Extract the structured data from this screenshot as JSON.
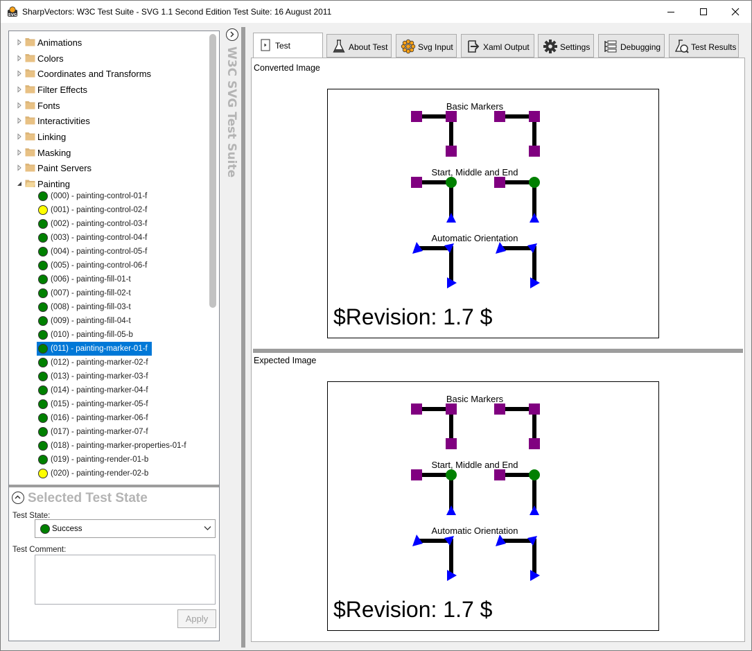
{
  "window": {
    "title": "SharpVectors: W3C Test Suite - SVG 1.1 Second Edition Test Suite: 16 August 2011"
  },
  "tree": {
    "folders": [
      {
        "label": "Animations",
        "expanded": false
      },
      {
        "label": "Colors",
        "expanded": false
      },
      {
        "label": "Coordinates and Transforms",
        "expanded": false
      },
      {
        "label": "Filter Effects",
        "expanded": false
      },
      {
        "label": "Fonts",
        "expanded": false
      },
      {
        "label": "Interactivities",
        "expanded": false
      },
      {
        "label": "Linking",
        "expanded": false
      },
      {
        "label": "Masking",
        "expanded": false
      },
      {
        "label": "Paint Servers",
        "expanded": false
      },
      {
        "label": "Painting",
        "expanded": true
      }
    ],
    "tests": [
      {
        "label": "(000) - painting-control-01-f",
        "status": "green"
      },
      {
        "label": "(001) - painting-control-02-f",
        "status": "yellow"
      },
      {
        "label": "(002) - painting-control-03-f",
        "status": "green"
      },
      {
        "label": "(003) - painting-control-04-f",
        "status": "green"
      },
      {
        "label": "(004) - painting-control-05-f",
        "status": "green"
      },
      {
        "label": "(005) - painting-control-06-f",
        "status": "green"
      },
      {
        "label": "(006) - painting-fill-01-t",
        "status": "green"
      },
      {
        "label": "(007) - painting-fill-02-t",
        "status": "green"
      },
      {
        "label": "(008) - painting-fill-03-t",
        "status": "green"
      },
      {
        "label": "(009) - painting-fill-04-t",
        "status": "green"
      },
      {
        "label": "(010) - painting-fill-05-b",
        "status": "green"
      },
      {
        "label": "(011) - painting-marker-01-f",
        "status": "green",
        "selected": true
      },
      {
        "label": "(012) - painting-marker-02-f",
        "status": "green"
      },
      {
        "label": "(013) - painting-marker-03-f",
        "status": "green"
      },
      {
        "label": "(014) - painting-marker-04-f",
        "status": "green"
      },
      {
        "label": "(015) - painting-marker-05-f",
        "status": "green"
      },
      {
        "label": "(016) - painting-marker-06-f",
        "status": "green"
      },
      {
        "label": "(017) - painting-marker-07-f",
        "status": "green"
      },
      {
        "label": "(018) - painting-marker-properties-01-f",
        "status": "green"
      },
      {
        "label": "(019) - painting-render-01-b",
        "status": "green"
      },
      {
        "label": "(020) - painting-render-02-b",
        "status": "yellow"
      }
    ]
  },
  "state_panel": {
    "title": "Selected Test State",
    "state_label": "Test State:",
    "state_value": "Success",
    "comment_label": "Test Comment:",
    "comment_value": "",
    "apply_label": "Apply"
  },
  "side_strip": {
    "label": "W3C SVG Test Suite"
  },
  "tabs": [
    {
      "label": "Test",
      "icon": "test-page-icon",
      "active": true
    },
    {
      "label": "About Test",
      "icon": "flask-icon"
    },
    {
      "label": "Svg Input",
      "icon": "svg-logo-icon"
    },
    {
      "label": "Xaml Output",
      "icon": "export-arrow-icon"
    },
    {
      "label": "Settings",
      "icon": "gear-icon"
    },
    {
      "label": "Debugging",
      "icon": "debug-icon"
    },
    {
      "label": "Test Results",
      "icon": "test-results-icon"
    }
  ],
  "converted": {
    "section_title": "Converted Image",
    "labels": [
      "Basic Markers",
      "Start, Middle and End",
      "Automatic Orientation"
    ],
    "revision": "$Revision: 1.7 $"
  },
  "expected": {
    "section_title": "Expected Image",
    "labels": [
      "Basic Markers",
      "Start, Middle and End",
      "Automatic Orientation"
    ],
    "revision": "$Revision: 1.7 $"
  },
  "colors": {
    "status_green": "#008000",
    "status_yellow": "#ffff00",
    "selection": "#0078d7",
    "marker_purple": "#800080",
    "marker_green": "#008000",
    "marker_blue": "#0000ff"
  }
}
